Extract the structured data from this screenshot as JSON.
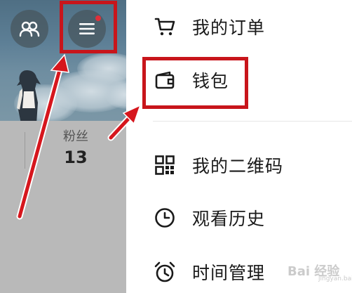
{
  "profile": {
    "fans_label": "粉丝",
    "fans_count": "13",
    "icons": {
      "friends": "friends-icon",
      "menu": "hamburger-menu-icon"
    },
    "notification_dot_color": "#e0303a"
  },
  "drawer": {
    "items": [
      {
        "label": "我的订单",
        "icon": "cart-icon"
      },
      {
        "label": "钱包",
        "icon": "wallet-icon"
      },
      {
        "label": "我的二维码",
        "icon": "qr-code-icon"
      },
      {
        "label": "观看历史",
        "icon": "clock-icon"
      },
      {
        "label": "时间管理",
        "icon": "alarm-clock-icon"
      }
    ]
  },
  "annotations": {
    "highlight_color": "#c8151b",
    "highlighted": [
      "menu-button",
      "wallet"
    ]
  },
  "watermark": {
    "text": "Bai 经验",
    "sub": "jingyan.baidu.com"
  }
}
